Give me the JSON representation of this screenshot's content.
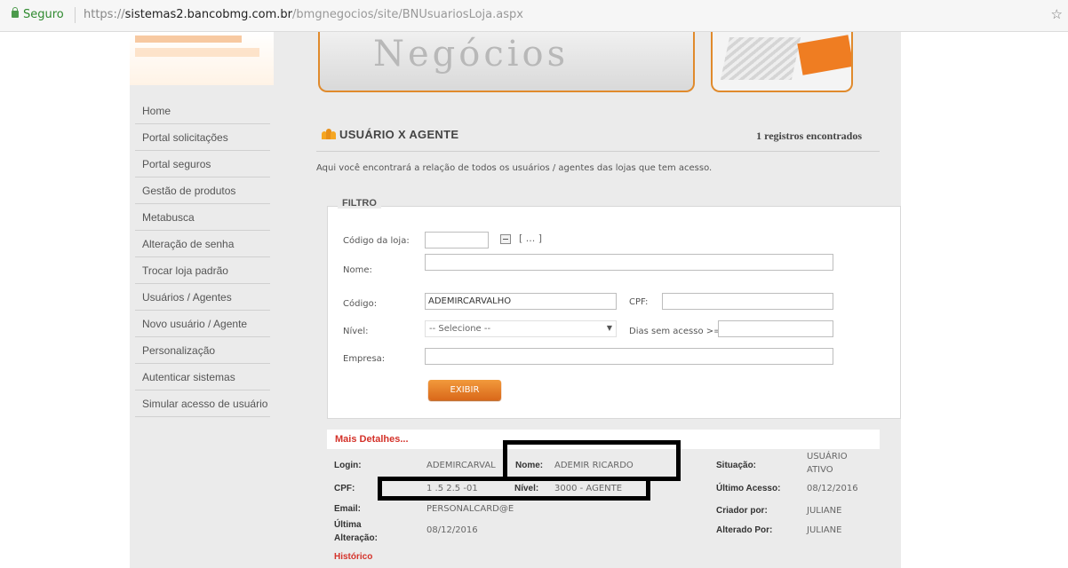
{
  "browser": {
    "secure_label": "Seguro",
    "url_protocol": "https://",
    "url_host": "sistemas2.bancobmg.com.br",
    "url_path": "/bmgnegocios/site/BNUsuariosLoja.aspx",
    "bookmark_icon": "star-icon"
  },
  "banner": {
    "text": "Negócios"
  },
  "sidebar": {
    "items": [
      {
        "label": "Home"
      },
      {
        "label": "Portal solicitações"
      },
      {
        "label": "Portal seguros"
      },
      {
        "label": "Gestão de produtos"
      },
      {
        "label": "Metabusca"
      },
      {
        "label": "Alteração de senha"
      },
      {
        "label": "Trocar loja padrão"
      },
      {
        "label": "Usuários / Agentes"
      },
      {
        "label": "Novo usuário / Agente"
      },
      {
        "label": "Personalização"
      },
      {
        "label": "Autenticar sistemas"
      },
      {
        "label": "Simular acesso de usuário"
      }
    ]
  },
  "main": {
    "title": "USUÁRIO X AGENTE",
    "records_found": "1 registros encontrados",
    "description": "Aqui você encontrará a relação de todos os usuários / agentes das lojas que tem acesso."
  },
  "filter": {
    "legend": "FILTRO",
    "codigo_loja_label": "Código da loja:",
    "codigo_loja_value": "",
    "lookup_text": "[ ... ]",
    "nome_label": "Nome:",
    "nome_value": "",
    "codigo_label": "Código:",
    "codigo_value": "ADEMIRCARVALHO",
    "cpf_label": "CPF:",
    "cpf_value": "",
    "nivel_label": "Nível:",
    "nivel_selected": "-- Selecione --",
    "dias_label": "Dias sem acesso >=",
    "dias_value": "",
    "empresa_label": "Empresa:",
    "empresa_value": "",
    "exibir_button": "EXIBIR"
  },
  "result": {
    "mais_detalhes": "Mais Detalhes...",
    "login_label": "Login:",
    "login_value": "ADEMIRCARVAL",
    "nome_label": "Nome:",
    "nome_value": "ADEMIR RICARDO",
    "situacao_label": "Situação:",
    "situacao_value_line1": "USUÁRIO",
    "situacao_value_line2": "ATIVO",
    "cpf_label": "CPF:",
    "cpf_value": "1 .5 2.5 -01",
    "nivel_label": "Nível:",
    "nivel_value": "3000 - AGENTE",
    "ultimo_acesso_label": "Último Acesso:",
    "ultimo_acesso_value": "08/12/2016",
    "email_label": "Email:",
    "email_value": "PERSONALCARD@E",
    "criador_label": "Criador por:",
    "criador_value": "JULIANE",
    "ultima_label_line1": "Última",
    "ultima_label_line2": "Alteração:",
    "ultima_value": "08/12/2016",
    "alterado_label": "Alterado Por:",
    "alterado_value": "JULIANE",
    "historico": "Histórico"
  }
}
